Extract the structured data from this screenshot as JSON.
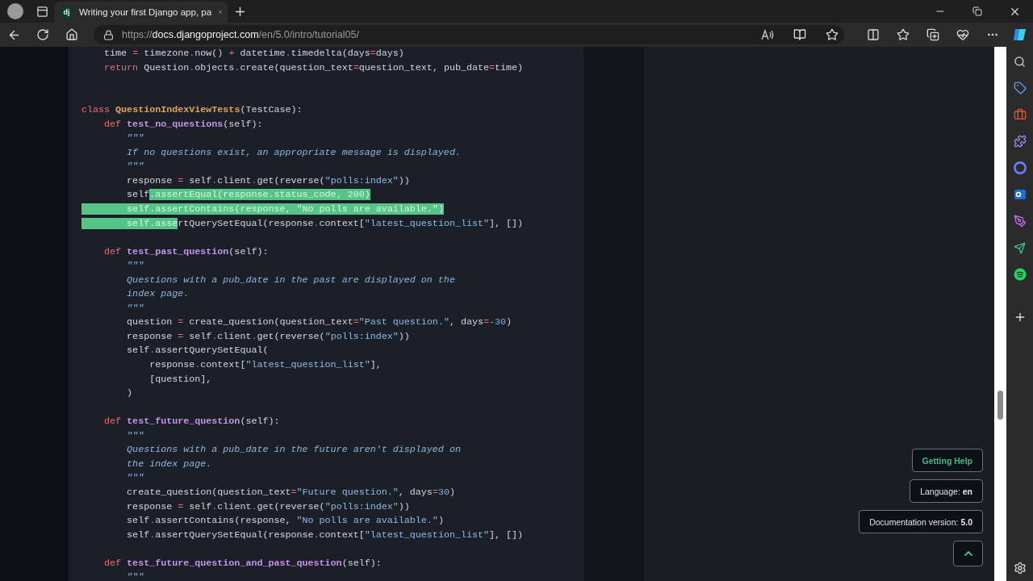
{
  "browser": {
    "tab": {
      "favicon": "dj",
      "title": "Writing your first Django app, pa",
      "selected": true
    },
    "url": {
      "scheme": "https://",
      "host": "docs.djangoproject.com",
      "path": "/en/5.0/intro/tutorial05/"
    }
  },
  "code": [
    {
      "kind": "code",
      "tokens": [
        {
          "kind": "pl",
          "text": "    time ",
          "selected": false
        },
        {
          "kind": "op",
          "text": "=",
          "selected": false
        },
        {
          "kind": "pl",
          "text": " timezone",
          "selected": false
        },
        {
          "kind": "op",
          "text": ".",
          "selected": false
        },
        {
          "kind": "pl",
          "text": "now() ",
          "selected": false
        },
        {
          "kind": "op",
          "text": "+",
          "selected": false
        },
        {
          "kind": "pl",
          "text": " datetime",
          "selected": false
        },
        {
          "kind": "op",
          "text": ".",
          "selected": false
        },
        {
          "kind": "pl",
          "text": "timedelta(days",
          "selected": false
        },
        {
          "kind": "op",
          "text": "=",
          "selected": false
        },
        {
          "kind": "pl",
          "text": "days)",
          "selected": false
        }
      ]
    },
    {
      "kind": "code",
      "tokens": [
        {
          "kind": "kw",
          "text": "    return",
          "selected": false
        },
        {
          "kind": "pl",
          "text": " Question",
          "selected": false
        },
        {
          "kind": "op",
          "text": ".",
          "selected": false
        },
        {
          "kind": "pl",
          "text": "objects",
          "selected": false
        },
        {
          "kind": "op",
          "text": ".",
          "selected": false
        },
        {
          "kind": "pl",
          "text": "create(question_text",
          "selected": false
        },
        {
          "kind": "op",
          "text": "=",
          "selected": false
        },
        {
          "kind": "pl",
          "text": "question_text, pub_date",
          "selected": false
        },
        {
          "kind": "op",
          "text": "=",
          "selected": false
        },
        {
          "kind": "pl",
          "text": "time)",
          "selected": false
        }
      ]
    },
    {
      "kind": "blank"
    },
    {
      "kind": "blank"
    },
    {
      "kind": "code",
      "tokens": [
        {
          "kind": "kw",
          "text": "class ",
          "selected": false
        },
        {
          "kind": "cls",
          "text": "QuestionIndexViewTests",
          "selected": false
        },
        {
          "kind": "pl",
          "text": "(TestCase):",
          "selected": false
        }
      ]
    },
    {
      "kind": "code",
      "tokens": [
        {
          "kind": "kw",
          "text": "    def ",
          "selected": false
        },
        {
          "kind": "fn",
          "text": "test_no_questions",
          "selected": false
        },
        {
          "kind": "pl",
          "text": "(self):",
          "selected": false
        }
      ]
    },
    {
      "kind": "code",
      "tokens": [
        {
          "kind": "doc",
          "text": "        \"\"\"",
          "selected": false
        }
      ]
    },
    {
      "kind": "code",
      "tokens": [
        {
          "kind": "doc",
          "text": "        If no questions exist, an appropriate message is displayed.",
          "selected": false
        }
      ]
    },
    {
      "kind": "code",
      "tokens": [
        {
          "kind": "doc",
          "text": "        \"\"\"",
          "selected": false
        }
      ]
    },
    {
      "kind": "code",
      "tokens": [
        {
          "kind": "pl",
          "text": "        response ",
          "selected": false
        },
        {
          "kind": "op",
          "text": "=",
          "selected": false
        },
        {
          "kind": "pl",
          "text": " self",
          "selected": false
        },
        {
          "kind": "op",
          "text": ".",
          "selected": false
        },
        {
          "kind": "pl",
          "text": "client",
          "selected": false
        },
        {
          "kind": "op",
          "text": ".",
          "selected": false
        },
        {
          "kind": "pl",
          "text": "get(reverse(",
          "selected": false
        },
        {
          "kind": "str",
          "text": "\"polls:index\"",
          "selected": false
        },
        {
          "kind": "pl",
          "text": "))",
          "selected": false
        }
      ]
    },
    {
      "kind": "code",
      "tokens": [
        {
          "kind": "pl",
          "text": "        self",
          "selected": false
        },
        {
          "kind": "op",
          "text": ".",
          "selected": true
        },
        {
          "kind": "pl",
          "text": "assertEqual(response",
          "selected": true
        },
        {
          "kind": "op",
          "text": ".",
          "selected": true
        },
        {
          "kind": "pl",
          "text": "status_code, ",
          "selected": true
        },
        {
          "kind": "num",
          "text": "200",
          "selected": true
        },
        {
          "kind": "pl",
          "text": ")",
          "selected": true
        }
      ]
    },
    {
      "kind": "code",
      "tokens": [
        {
          "kind": "pl",
          "text": "        self",
          "selected": true
        },
        {
          "kind": "op",
          "text": ".",
          "selected": true
        },
        {
          "kind": "pl",
          "text": "assertContains(response, ",
          "selected": true
        },
        {
          "kind": "str",
          "text": "\"No polls are available.\"",
          "selected": true
        },
        {
          "kind": "pl",
          "text": ")",
          "selected": true
        }
      ]
    },
    {
      "kind": "code",
      "tokens": [
        {
          "kind": "pl",
          "text": "        self",
          "selected": true
        },
        {
          "kind": "op",
          "text": ".",
          "selected": true
        },
        {
          "kind": "pl",
          "text": "asse",
          "selected": true
        },
        {
          "kind": "pl",
          "text": "rtQuerySetEqual(response",
          "selected": false
        },
        {
          "kind": "op",
          "text": ".",
          "selected": false
        },
        {
          "kind": "pl",
          "text": "context[",
          "selected": false
        },
        {
          "kind": "str",
          "text": "\"latest_question_list\"",
          "selected": false
        },
        {
          "kind": "pl",
          "text": "], [])",
          "selected": false
        }
      ]
    },
    {
      "kind": "blank"
    },
    {
      "kind": "code",
      "tokens": [
        {
          "kind": "kw",
          "text": "    def ",
          "selected": false
        },
        {
          "kind": "fn",
          "text": "test_past_question",
          "selected": false
        },
        {
          "kind": "pl",
          "text": "(self):",
          "selected": false
        }
      ]
    },
    {
      "kind": "code",
      "tokens": [
        {
          "kind": "doc",
          "text": "        \"\"\"",
          "selected": false
        }
      ]
    },
    {
      "kind": "code",
      "tokens": [
        {
          "kind": "doc",
          "text": "        Questions with a pub_date in the past are displayed on the",
          "selected": false
        }
      ]
    },
    {
      "kind": "code",
      "tokens": [
        {
          "kind": "doc",
          "text": "        index page.",
          "selected": false
        }
      ]
    },
    {
      "kind": "code",
      "tokens": [
        {
          "kind": "doc",
          "text": "        \"\"\"",
          "selected": false
        }
      ]
    },
    {
      "kind": "code",
      "tokens": [
        {
          "kind": "pl",
          "text": "        question ",
          "selected": false
        },
        {
          "kind": "op",
          "text": "=",
          "selected": false
        },
        {
          "kind": "pl",
          "text": " create_question(question_text",
          "selected": false
        },
        {
          "kind": "op",
          "text": "=",
          "selected": false
        },
        {
          "kind": "str",
          "text": "\"Past question.\"",
          "selected": false
        },
        {
          "kind": "pl",
          "text": ", days",
          "selected": false
        },
        {
          "kind": "op",
          "text": "=",
          "selected": false
        },
        {
          "kind": "num",
          "text": "-30",
          "selected": false
        },
        {
          "kind": "pl",
          "text": ")",
          "selected": false
        }
      ]
    },
    {
      "kind": "code",
      "tokens": [
        {
          "kind": "pl",
          "text": "        response ",
          "selected": false
        },
        {
          "kind": "op",
          "text": "=",
          "selected": false
        },
        {
          "kind": "pl",
          "text": " self",
          "selected": false
        },
        {
          "kind": "op",
          "text": ".",
          "selected": false
        },
        {
          "kind": "pl",
          "text": "client",
          "selected": false
        },
        {
          "kind": "op",
          "text": ".",
          "selected": false
        },
        {
          "kind": "pl",
          "text": "get(reverse(",
          "selected": false
        },
        {
          "kind": "str",
          "text": "\"polls:index\"",
          "selected": false
        },
        {
          "kind": "pl",
          "text": "))",
          "selected": false
        }
      ]
    },
    {
      "kind": "code",
      "tokens": [
        {
          "kind": "pl",
          "text": "        self",
          "selected": false
        },
        {
          "kind": "op",
          "text": ".",
          "selected": false
        },
        {
          "kind": "pl",
          "text": "assertQuerySetEqual(",
          "selected": false
        }
      ]
    },
    {
      "kind": "code",
      "tokens": [
        {
          "kind": "pl",
          "text": "            response",
          "selected": false
        },
        {
          "kind": "op",
          "text": ".",
          "selected": false
        },
        {
          "kind": "pl",
          "text": "context[",
          "selected": false
        },
        {
          "kind": "str",
          "text": "\"latest_question_list\"",
          "selected": false
        },
        {
          "kind": "pl",
          "text": "],",
          "selected": false
        }
      ]
    },
    {
      "kind": "code",
      "tokens": [
        {
          "kind": "pl",
          "text": "            [question],",
          "selected": false
        }
      ]
    },
    {
      "kind": "code",
      "tokens": [
        {
          "kind": "pl",
          "text": "        )",
          "selected": false
        }
      ]
    },
    {
      "kind": "blank"
    },
    {
      "kind": "code",
      "tokens": [
        {
          "kind": "kw",
          "text": "    def ",
          "selected": false
        },
        {
          "kind": "fn",
          "text": "test_future_question",
          "selected": false
        },
        {
          "kind": "pl",
          "text": "(self):",
          "selected": false
        }
      ]
    },
    {
      "kind": "code",
      "tokens": [
        {
          "kind": "doc",
          "text": "        \"\"\"",
          "selected": false
        }
      ]
    },
    {
      "kind": "code",
      "tokens": [
        {
          "kind": "doc",
          "text": "        Questions with a pub_date in the future aren't displayed on",
          "selected": false
        }
      ]
    },
    {
      "kind": "code",
      "tokens": [
        {
          "kind": "doc",
          "text": "        the index page.",
          "selected": false
        }
      ]
    },
    {
      "kind": "code",
      "tokens": [
        {
          "kind": "doc",
          "text": "        \"\"\"",
          "selected": false
        }
      ]
    },
    {
      "kind": "code",
      "tokens": [
        {
          "kind": "pl",
          "text": "        create_question(question_text",
          "selected": false
        },
        {
          "kind": "op",
          "text": "=",
          "selected": false
        },
        {
          "kind": "str",
          "text": "\"Future question.\"",
          "selected": false
        },
        {
          "kind": "pl",
          "text": ", days",
          "selected": false
        },
        {
          "kind": "op",
          "text": "=",
          "selected": false
        },
        {
          "kind": "num",
          "text": "30",
          "selected": false
        },
        {
          "kind": "pl",
          "text": ")",
          "selected": false
        }
      ]
    },
    {
      "kind": "code",
      "tokens": [
        {
          "kind": "pl",
          "text": "        response ",
          "selected": false
        },
        {
          "kind": "op",
          "text": "=",
          "selected": false
        },
        {
          "kind": "pl",
          "text": " self",
          "selected": false
        },
        {
          "kind": "op",
          "text": ".",
          "selected": false
        },
        {
          "kind": "pl",
          "text": "client",
          "selected": false
        },
        {
          "kind": "op",
          "text": ".",
          "selected": false
        },
        {
          "kind": "pl",
          "text": "get(reverse(",
          "selected": false
        },
        {
          "kind": "str",
          "text": "\"polls:index\"",
          "selected": false
        },
        {
          "kind": "pl",
          "text": "))",
          "selected": false
        }
      ]
    },
    {
      "kind": "code",
      "tokens": [
        {
          "kind": "pl",
          "text": "        self",
          "selected": false
        },
        {
          "kind": "op",
          "text": ".",
          "selected": false
        },
        {
          "kind": "pl",
          "text": "assertContains(response, ",
          "selected": false
        },
        {
          "kind": "str",
          "text": "\"No polls are available.\"",
          "selected": false
        },
        {
          "kind": "pl",
          "text": ")",
          "selected": false
        }
      ]
    },
    {
      "kind": "code",
      "tokens": [
        {
          "kind": "pl",
          "text": "        self",
          "selected": false
        },
        {
          "kind": "op",
          "text": ".",
          "selected": false
        },
        {
          "kind": "pl",
          "text": "assertQuerySetEqual(response",
          "selected": false
        },
        {
          "kind": "op",
          "text": ".",
          "selected": false
        },
        {
          "kind": "pl",
          "text": "context[",
          "selected": false
        },
        {
          "kind": "str",
          "text": "\"latest_question_list\"",
          "selected": false
        },
        {
          "kind": "pl",
          "text": "], [])",
          "selected": false
        }
      ]
    },
    {
      "kind": "blank"
    },
    {
      "kind": "code",
      "tokens": [
        {
          "kind": "kw",
          "text": "    def ",
          "selected": false
        },
        {
          "kind": "fn",
          "text": "test_future_question_and_past_question",
          "selected": false
        },
        {
          "kind": "pl",
          "text": "(self):",
          "selected": false
        }
      ]
    },
    {
      "kind": "code",
      "tokens": [
        {
          "kind": "doc",
          "text": "        \"\"\"",
          "selected": false
        }
      ]
    }
  ],
  "floating_buttons": [
    {
      "kind": "link",
      "label": "Getting Help"
    },
    {
      "kind": "menu",
      "label": "Language: **en**"
    },
    {
      "kind": "menu",
      "label": "Documentation version: **5.0**"
    }
  ]
}
